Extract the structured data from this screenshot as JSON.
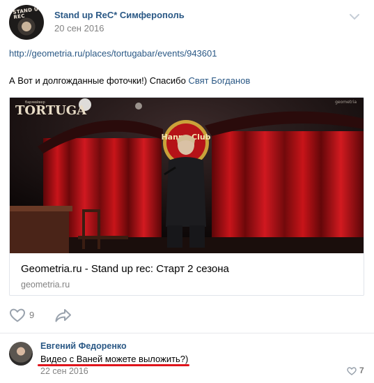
{
  "post": {
    "author": "Stand up ReC* Симферополь",
    "date": "20 сен 2016",
    "avatar_stamp": "STAND UP REC",
    "link_url": "http://geometria.ru/places/tortugabar/events/943601",
    "text_main": "А Вот и долгожданные фоточки!) Спасибо ",
    "text_mention": "Свят Богданов"
  },
  "card": {
    "title": "Geometria.ru - Stand up rec: Старт 2 сезона",
    "domain": "geometria.ru",
    "photo_logo": "TORTUGA",
    "photo_logo_small": "бармейвер",
    "photo_sign": "Hanna Club",
    "photo_watermark": "geometria"
  },
  "actions": {
    "like_count": "9"
  },
  "comment": {
    "author": "Евгений Федоренко",
    "text": "Видео с Ваней можете выложить?)",
    "date": "22 сен 2016",
    "like_count": "7"
  },
  "colors": {
    "link": "#2a5885",
    "meta": "#828282",
    "underline": "#e0141c"
  },
  "icons": [
    "chevron-down-icon",
    "heart-icon",
    "share-arrow-icon"
  ]
}
